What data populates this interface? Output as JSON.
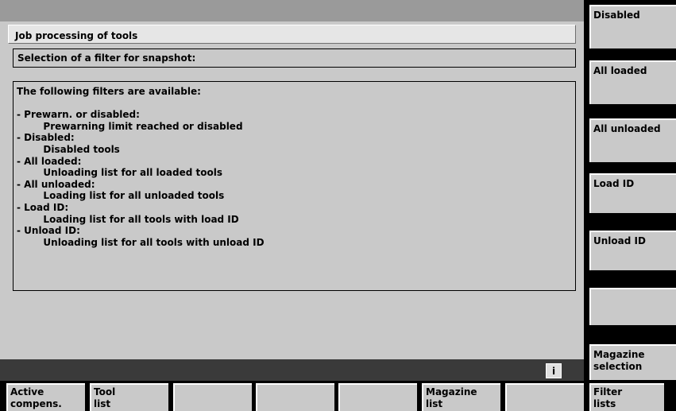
{
  "header": {
    "title": "Job processing of tools",
    "selection": "Selection of a filter for snapshot:"
  },
  "info": {
    "text": "The following filters are available:\n\n- Prewarn. or disabled:\n        Prewarning limit reached or disabled\n- Disabled:\n        Disabled tools\n- All loaded:\n        Unloading list for all loaded tools\n- All unloaded:\n        Loading list for all unloaded tools\n- Load ID:\n        Loading list for all tools with load ID\n- Unload ID:\n        Unloading list for all tools with unload ID"
  },
  "status": {
    "info_button": "i"
  },
  "vertical_softkeys": [
    {
      "label": "Disabled"
    },
    {
      "label": "All  loaded"
    },
    {
      "label": "All  unloaded"
    },
    {
      "label": "Load  ID"
    },
    {
      "label": "Unload  ID"
    },
    {
      "label": ""
    },
    {
      "label": "Magazine\nselection"
    }
  ],
  "horizontal_softkeys": [
    {
      "label": "Active\ncompens."
    },
    {
      "label": "Tool\nlist"
    },
    {
      "label": ""
    },
    {
      "label": ""
    },
    {
      "label": ""
    },
    {
      "label": "Magazine\nlist"
    },
    {
      "label": ""
    },
    {
      "label": "Filter\nlists"
    }
  ]
}
